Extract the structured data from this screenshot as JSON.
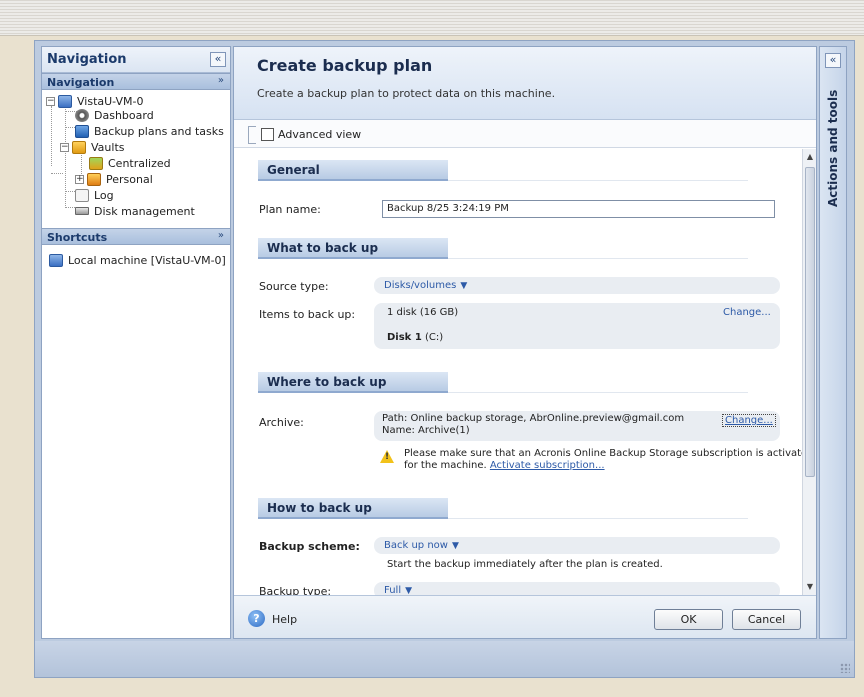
{
  "nav": {
    "title": "Navigation",
    "collapse_glyph": "«",
    "section_label": "Navigation",
    "section_chevron": "»",
    "tree": [
      {
        "label": "VistaU-VM-0",
        "icon": "computer-icon"
      },
      {
        "label": "Dashboard",
        "icon": "dashboard-icon"
      },
      {
        "label": "Backup plans and tasks",
        "icon": "backup-plans-icon"
      },
      {
        "label": "Vaults",
        "icon": "vaults-icon"
      },
      {
        "label": "Centralized",
        "icon": "centralized-vault-icon"
      },
      {
        "label": "Personal",
        "icon": "personal-vault-icon"
      },
      {
        "label": "Log",
        "icon": "log-icon"
      },
      {
        "label": "Disk management",
        "icon": "disk-management-icon"
      }
    ],
    "shortcuts_label": "Shortcuts",
    "shortcuts": [
      {
        "label": "Local machine [VistaU-VM-0]",
        "icon": "computer-icon"
      }
    ]
  },
  "main": {
    "title": "Create backup plan",
    "subtitle": "Create a backup plan to protect data on this machine.",
    "advanced_view_label": "Advanced view",
    "sections": {
      "general": "General",
      "what": "What to back up",
      "where": "Where to back up",
      "how": "How to back up"
    },
    "fields": {
      "plan_name_label": "Plan name:",
      "plan_name_value": "Backup 8/25 3:24:19 PM",
      "source_type_label": "Source type:",
      "source_type_value": "Disks/volumes",
      "items_label": "Items to back up:",
      "items_summary": "1 disk (16 GB)",
      "items_change": "Change...",
      "disk_name": "Disk 1",
      "disk_vol": "(C:)",
      "archive_label": "Archive:",
      "archive_path": "Path: Online backup storage, AbrOnline.preview@gmail.com",
      "archive_name": "Name: Archive(1)",
      "archive_change": "Change...",
      "warning_line1": "Please make sure that an Acronis Online Backup Storage subscription is activated",
      "warning_line2": "for the machine.",
      "warning_link": "Activate subscription...",
      "scheme_label": "Backup scheme:",
      "scheme_value": "Back up now",
      "scheme_desc": "Start the backup immediately after the plan is created.",
      "type_label": "Backup type:",
      "type_value": "Full"
    },
    "footer": {
      "help_label": "Help",
      "ok_label": "OK",
      "cancel_label": "Cancel"
    }
  },
  "actions_pane": {
    "label": "Actions and tools",
    "collapse_glyph": "«"
  }
}
